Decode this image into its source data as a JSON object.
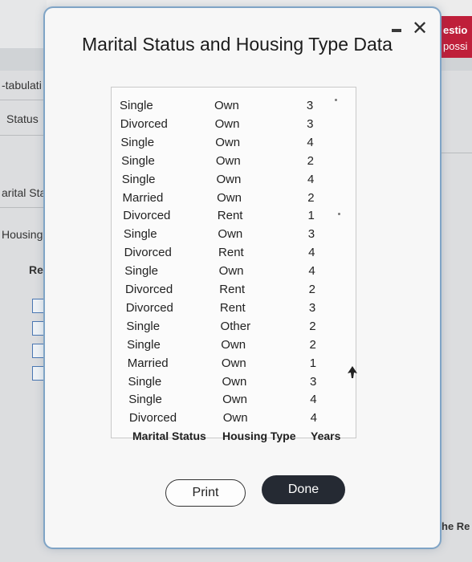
{
  "background": {
    "left_labels": [
      "-tabulati",
      "Status",
      "arital Sta",
      "Housing T",
      "Ren"
    ],
    "right_labels": [
      "estio",
      "possi"
    ],
    "bottom_right_label": "he Re"
  },
  "dialog": {
    "title": "Marital Status and Housing Type Data",
    "print_label": "Print",
    "done_label": "Done"
  },
  "table": {
    "headers": {
      "marital": "Marital Status",
      "housing": "Housing Type",
      "years": "Years"
    },
    "rows": [
      {
        "marital": "Single",
        "housing": "Own",
        "years": "3"
      },
      {
        "marital": "Divorced",
        "housing": "Own",
        "years": "3"
      },
      {
        "marital": "Single",
        "housing": "Own",
        "years": "4"
      },
      {
        "marital": "Single",
        "housing": "Own",
        "years": "2"
      },
      {
        "marital": "Single",
        "housing": "Own",
        "years": "4"
      },
      {
        "marital": "Married",
        "housing": "Own",
        "years": "2"
      },
      {
        "marital": "Divorced",
        "housing": "Rent",
        "years": "1"
      },
      {
        "marital": "Single",
        "housing": "Own",
        "years": "3"
      },
      {
        "marital": "Divorced",
        "housing": "Rent",
        "years": "4"
      },
      {
        "marital": "Single",
        "housing": "Own",
        "years": "4"
      },
      {
        "marital": "Divorced",
        "housing": "Rent",
        "years": "2"
      },
      {
        "marital": "Divorced",
        "housing": "Rent",
        "years": "3"
      },
      {
        "marital": "Single",
        "housing": "Other",
        "years": "2"
      },
      {
        "marital": "Single",
        "housing": "Own",
        "years": "2"
      },
      {
        "marital": "Married",
        "housing": "Own",
        "years": "1"
      },
      {
        "marital": "Single",
        "housing": "Own",
        "years": "3"
      },
      {
        "marital": "Single",
        "housing": "Own",
        "years": "4"
      },
      {
        "marital": "Divorced",
        "housing": "Own",
        "years": "4"
      }
    ]
  },
  "icons": {
    "close": "close-icon",
    "minimize": "minimize-icon",
    "cursor": "mouse-cursor-icon",
    "checkbox": "checkbox-icon"
  },
  "colors": {
    "done_button": "#252a33",
    "dialog_border": "#7fa4c6",
    "header_red": "#bf1f3a",
    "checkbox_border": "#4a77b3"
  }
}
